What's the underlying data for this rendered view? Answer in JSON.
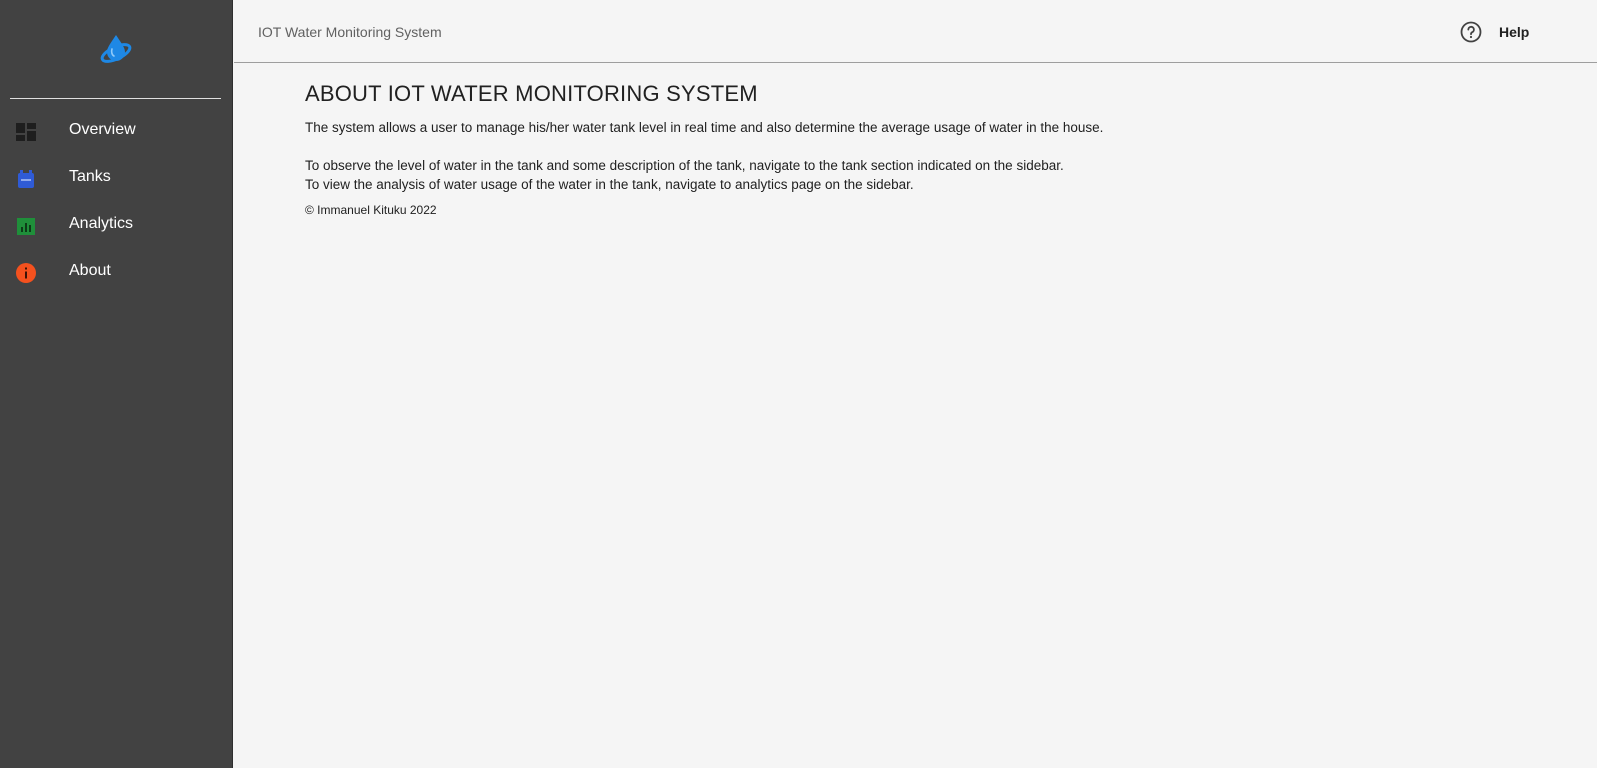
{
  "app": {
    "title": "IOT Water Monitoring System"
  },
  "header": {
    "help_label": "Help",
    "help_icon": "help-circle-icon"
  },
  "sidebar": {
    "logo_icon": "water-drop-globe-icon",
    "items": [
      {
        "label": "Overview",
        "icon": "dashboard-icon",
        "color": "#1e1e1e"
      },
      {
        "label": "Tanks",
        "icon": "tank-icon",
        "color": "#2f5bd6"
      },
      {
        "label": "Analytics",
        "icon": "analytics-icon",
        "color": "#1f8f3a"
      },
      {
        "label": "About",
        "icon": "info-icon",
        "color": "#f4511e"
      }
    ]
  },
  "main": {
    "heading": "ABOUT IOT WATER MONITORING SYSTEM",
    "paragraphs": [
      "The system allows a user to manage his/her water tank level in real time and also determine the average usage of water in the house.",
      "To observe the level of water in the tank and some description of the tank, navigate to the tank section indicated on the sidebar.",
      "To view the analysis of water usage of the water in the tank, navigate to analytics page on the sidebar."
    ],
    "copyright": "© Immanuel Kituku 2022"
  },
  "colors": {
    "sidebar_bg": "#424242",
    "page_bg": "#f5f5f5",
    "logo_blue": "#1e88e5"
  }
}
